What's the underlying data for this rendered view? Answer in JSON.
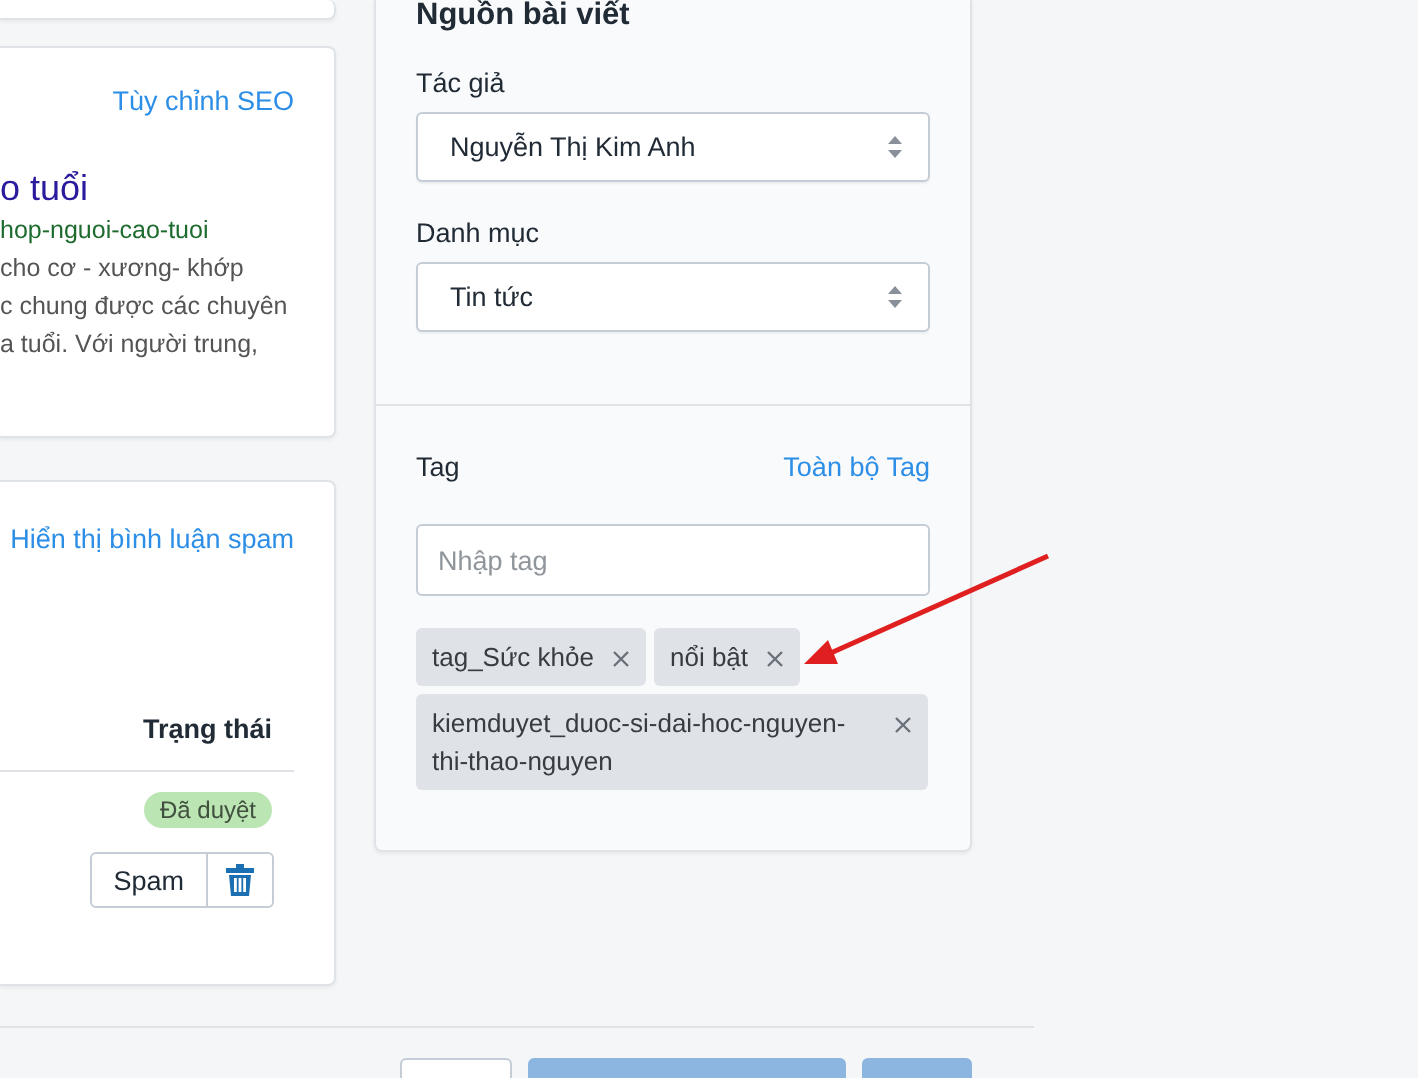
{
  "seo_card": {
    "link": "Tùy chỉnh SEO",
    "preview_title": "o tuổi",
    "preview_url": "hop-nguoi-cao-tuoi",
    "preview_lines": [
      "cho cơ - xương- khớp",
      "c chung được các chuyên",
      "a tuổi. Với người trung,"
    ]
  },
  "comments_card": {
    "link": "Hiển thị bình luận spam",
    "column": "Trạng thái",
    "status": "Đã duyệt",
    "spam_button": "Spam"
  },
  "source_card": {
    "title": "Nguồn bài viết",
    "fields": [
      {
        "label": "Tác giả",
        "value": "Nguyễn Thị Kim Anh"
      },
      {
        "label": "Danh mục",
        "value": "Tin tức"
      }
    ],
    "tags": {
      "label": "Tag",
      "link": "Toàn bộ Tag",
      "placeholder": "Nhập tag",
      "items": [
        "tag_Sức khỏe",
        "nổi bật",
        "kiemduyet_duoc-si-dai-hoc-nguyen-thi-thao-nguyen"
      ]
    }
  },
  "footer_buttons": [
    {
      "kind": "secondary"
    },
    {
      "kind": "primary"
    },
    {
      "kind": "primary"
    }
  ]
}
